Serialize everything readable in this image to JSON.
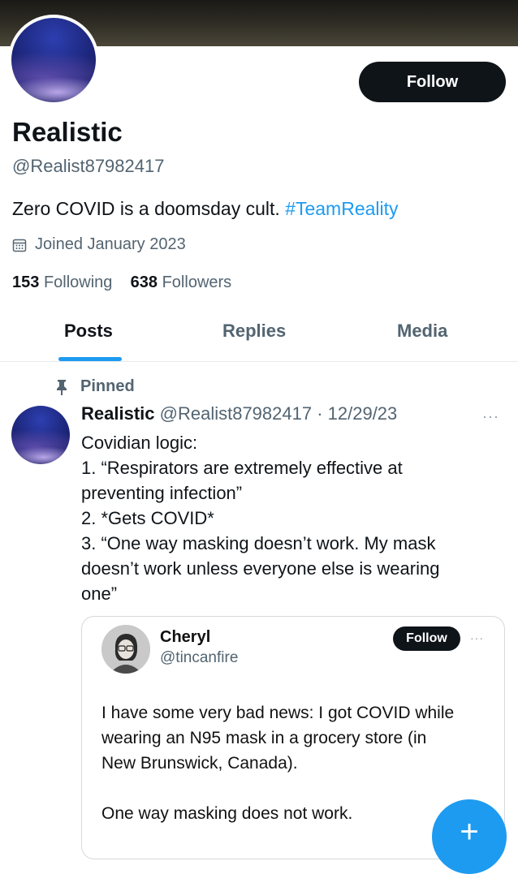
{
  "profile": {
    "name": "Realistic",
    "handle": "@Realist87982417",
    "bio_text": "Zero COVID is a doomsday cult.",
    "bio_hashtag": "#TeamReality",
    "joined": "Joined January 2023",
    "following_count": "153",
    "following_label": "Following",
    "followers_count": "638",
    "followers_label": "Followers",
    "follow_label": "Follow"
  },
  "tabs": [
    {
      "label": "Posts",
      "active": true
    },
    {
      "label": "Replies",
      "active": false
    },
    {
      "label": "Media",
      "active": false
    }
  ],
  "post": {
    "pinned_label": "Pinned",
    "author": "Realistic",
    "meta": "@Realist87982417 · 12/29/23",
    "more": "···",
    "lines": [
      "Covidian logic:",
      "1. “Respirators are extremely effective at",
      "preventing infection”",
      "2. *Gets COVID*",
      "3. “One way masking doesn’t work. My mask",
      "doesn’t work unless everyone else is wearing",
      "one”"
    ]
  },
  "quote": {
    "name": "Cheryl",
    "handle": "@tincanfire",
    "follow_label": "Follow",
    "more": "···",
    "lines": [
      "I have some very bad news: I got COVID while",
      "wearing an N95 mask in a grocery store (in",
      "New Brunswick, Canada)."
    ],
    "last_line": "One way masking does not work."
  },
  "fab": {
    "label": "+"
  },
  "colors": {
    "accent": "#1d9bf0",
    "text": "#0f1419",
    "muted": "#536471",
    "button_dark": "#0f1419"
  }
}
